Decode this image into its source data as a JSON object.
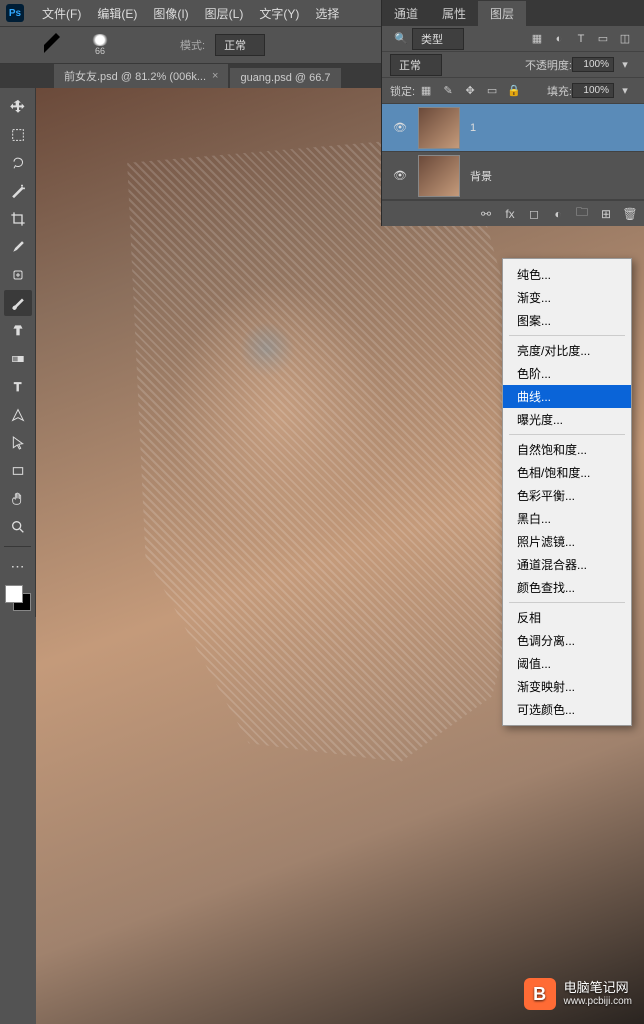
{
  "app": {
    "logo": "Ps"
  },
  "menubar": {
    "items": [
      "文件(F)",
      "编辑(E)",
      "图像(I)",
      "图层(L)",
      "文字(Y)",
      "选择"
    ]
  },
  "options": {
    "brush_size": "66",
    "mode_label": "模式:",
    "mode_value": "正常"
  },
  "tabs": [
    {
      "label": "前女友.psd @ 81.2% (006k...",
      "active": true
    },
    {
      "label": "guang.psd @ 66.7",
      "active": false
    }
  ],
  "panels": {
    "tabs": [
      "通道",
      "属性",
      "图层"
    ],
    "active_tab": 2,
    "filter_icon": "🔍",
    "filter_label": "类型",
    "blend_mode": "正常",
    "opacity_label": "不透明度:",
    "opacity_value": "100%",
    "lock_label": "锁定:",
    "fill_label": "填充:",
    "fill_value": "100%"
  },
  "layers": [
    {
      "name": "1",
      "visible": true,
      "selected": true
    },
    {
      "name": "背景",
      "visible": true,
      "selected": false
    }
  ],
  "context_menu": {
    "groups": [
      [
        "纯色...",
        "渐变...",
        "图案..."
      ],
      [
        "亮度/对比度...",
        "色阶...",
        "曲线...",
        "曝光度..."
      ],
      [
        "自然饱和度...",
        "色相/饱和度...",
        "色彩平衡...",
        "黑白...",
        "照片滤镜...",
        "通道混合器...",
        "颜色查找..."
      ],
      [
        "反相",
        "色调分离...",
        "阈值...",
        "渐变映射...",
        "可选颜色..."
      ]
    ],
    "highlighted": "曲线..."
  },
  "watermark": {
    "icon": "B",
    "title": "电脑笔记网",
    "url": "www.pcbiji.com"
  }
}
